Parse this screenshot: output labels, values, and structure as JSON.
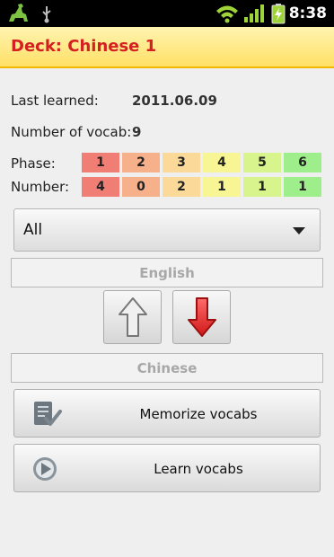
{
  "status_bar": {
    "time": "8:38",
    "icons": [
      "android-app-icon",
      "usb-icon",
      "wifi-icon",
      "signal-icon",
      "battery-charging-icon"
    ]
  },
  "header": {
    "title": "Deck: Chinese 1"
  },
  "info": {
    "last_learned_label": "Last learned:",
    "last_learned_value": "2011.06.09",
    "vocab_count_label": "Number of vocab:",
    "vocab_count_value": "9"
  },
  "phases": {
    "phase_label": "Phase:",
    "number_label": "Number:",
    "items": [
      {
        "phase": "1",
        "number": "4",
        "color": "#f07e74"
      },
      {
        "phase": "2",
        "number": "0",
        "color": "#f6b08a"
      },
      {
        "phase": "3",
        "number": "2",
        "color": "#fbd998"
      },
      {
        "phase": "4",
        "number": "1",
        "color": "#f8f694"
      },
      {
        "phase": "5",
        "number": "1",
        "color": "#d8f48c"
      },
      {
        "phase": "6",
        "number": "1",
        "color": "#9eee8c"
      }
    ]
  },
  "filter": {
    "selected": "All"
  },
  "direction": {
    "source_label": "English",
    "target_label": "Chinese",
    "up_icon": "up-arrow-icon",
    "down_icon": "down-arrow-icon"
  },
  "actions": {
    "memorize_label": "Memorize vocabs",
    "memorize_icon": "checklist-icon",
    "learn_label": "Learn vocabs",
    "learn_icon": "play-icon"
  }
}
